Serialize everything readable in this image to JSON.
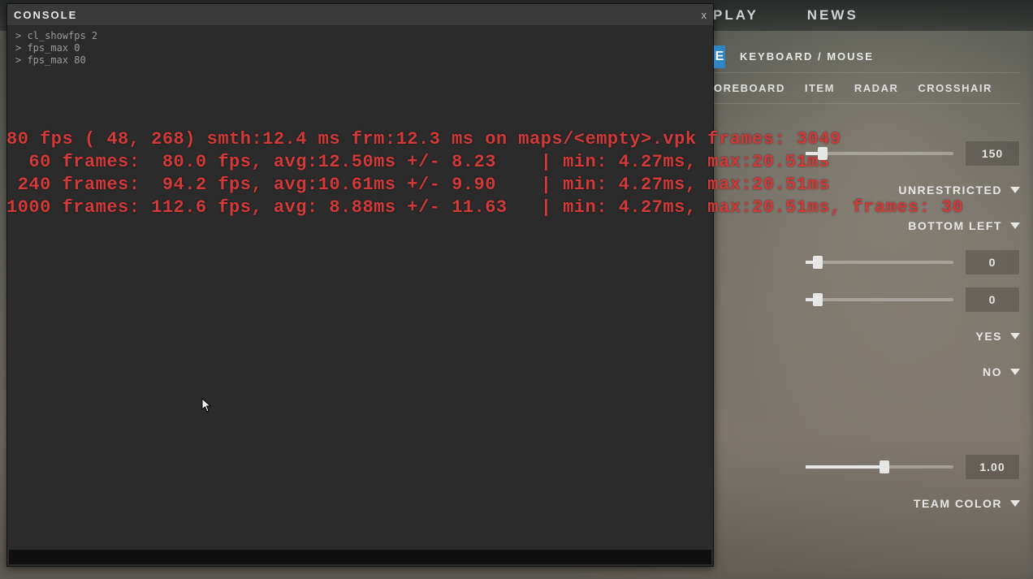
{
  "topnav": {
    "play": "PLAY",
    "news": "NEWS"
  },
  "console": {
    "title": "CONSOLE",
    "close": "x",
    "history": [
      "cl_showfps 2",
      "fps_max 0",
      "fps_max 80"
    ]
  },
  "fps": {
    "line0": "80 fps ( 48, 268) smth:12.4 ms frm:12.3 ms on maps/<empty>.vpk frames: 3049",
    "line1": "  60 frames:  80.0 fps, avg:12.50ms +/- 8.23    | min: 4.27ms, max:20.51ms",
    "line2": " 240 frames:  94.2 fps, avg:10.61ms +/- 9.90    | min: 4.27ms, max:20.51ms",
    "line3": "1000 frames: 112.6 fps, avg: 8.88ms +/- 11.63   | min: 4.27ms, max:20.51ms, frames: 30"
  },
  "settings": {
    "segment_letter": "E",
    "input_tab": "KEYBOARD / MOUSE",
    "subtabs": {
      "scoreboard": "OREBOARD",
      "item": "ITEM",
      "radar": "RADAR",
      "crosshair": "CROSSHAIR"
    },
    "values": {
      "box150": "150",
      "unrestricted": "UNRESTRICTED",
      "bottom_left": "BOTTOM LEFT",
      "zero_a": "0",
      "zero_b": "0",
      "yes": "YES",
      "no": "NO",
      "one": "1.00",
      "team_color": "TEAM COLOR"
    }
  }
}
